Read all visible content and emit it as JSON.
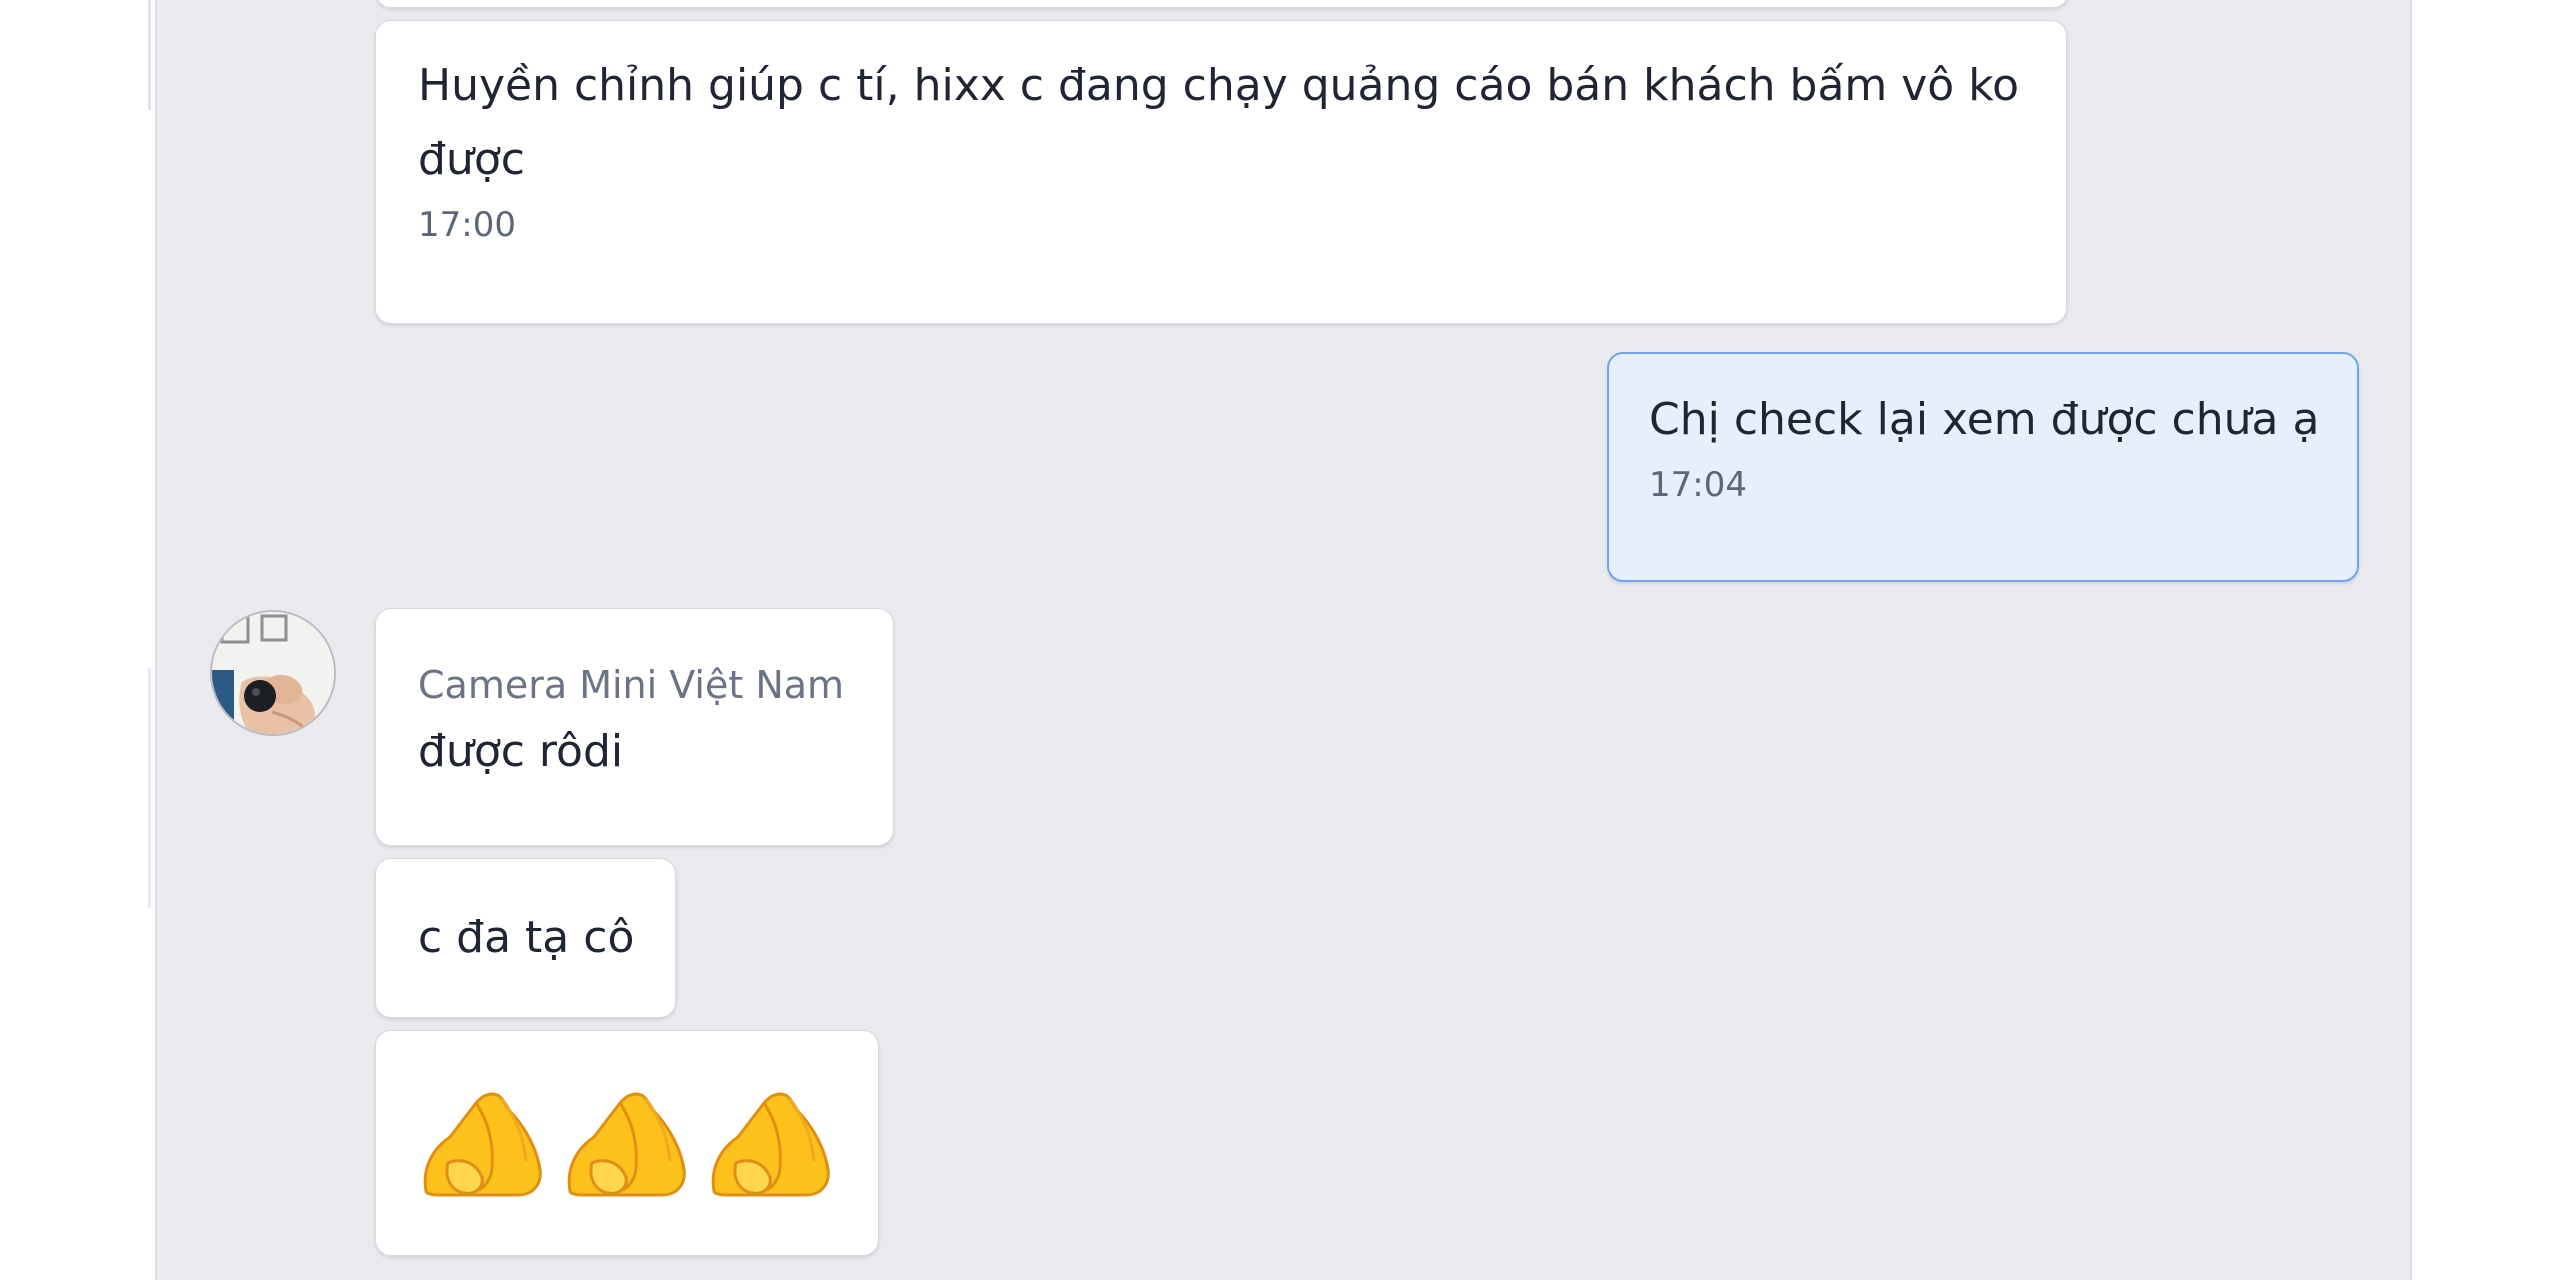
{
  "conversation": {
    "messages": [
      {
        "direction": "incoming",
        "text": "Huyền chỉnh giúp c tí, hixx c đang chạy quảng cáo bán khách bấm vô ko được",
        "time": "17:00"
      },
      {
        "direction": "outgoing",
        "text": "Chị check lại xem được chưa ạ",
        "time": "17:04"
      },
      {
        "direction": "incoming",
        "sender": "Camera Mini Việt Nam",
        "text": "được rôdi"
      },
      {
        "direction": "incoming",
        "text": "c đa tạ cô"
      },
      {
        "direction": "incoming",
        "emoji": [
          "folded-hands",
          "folded-hands",
          "folded-hands"
        ]
      }
    ]
  },
  "avatar_icon": "camera-mini-avatar-icon",
  "colors": {
    "chat_background": "#e9eaee",
    "incoming_bubble": "#ffffff",
    "outgoing_bubble": "#e6f0fd",
    "outgoing_border": "#72a3ef"
  }
}
